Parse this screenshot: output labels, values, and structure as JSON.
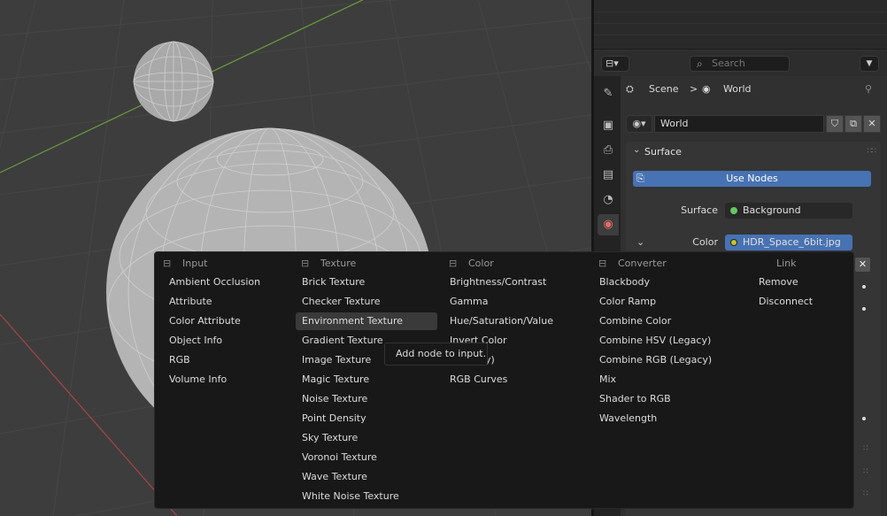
{
  "properties": {
    "header": {
      "editor_icon": "⊟",
      "search_placeholder": "Search",
      "dropdown_icon": "chevron-down"
    },
    "breadcrumb": {
      "scene": "Scene",
      "separator": ">",
      "world": "World",
      "pin_icon": "pin"
    },
    "world_selector": {
      "name": "World",
      "icon": "world-icon"
    },
    "surface_panel": {
      "title": "Surface",
      "use_nodes_label": "Use Nodes",
      "surface_label": "Surface",
      "surface_value": "Background",
      "color_label": "Color",
      "color_value": "HDR_Space_6bit.jpg"
    },
    "colors": {
      "accent": "#4772b3",
      "shader_socket": "#63c763",
      "color_socket": "#c7c729",
      "world_tab": "#e06c6c"
    }
  },
  "menu": {
    "columns": [
      {
        "heading": "Input",
        "items": [
          "Ambient Occlusion",
          "Attribute",
          "Color Attribute",
          "Object Info",
          "RGB",
          "Volume Info"
        ]
      },
      {
        "heading": "Texture",
        "items": [
          "Brick Texture",
          "Checker Texture",
          "Environment Texture",
          "Gradient Texture",
          "Image Texture",
          "Magic Texture",
          "Noise Texture",
          "Point Density",
          "Sky Texture",
          "Voronoi Texture",
          "Wave Texture",
          "White Noise Texture"
        ]
      },
      {
        "heading": "Color",
        "items": [
          "Brightness/Contrast",
          "Gamma",
          "Hue/Saturation/Value",
          "Invert Color",
          "cy)",
          "RGB Curves"
        ]
      },
      {
        "heading": "Converter",
        "items": [
          "Blackbody",
          "Color Ramp",
          "Combine Color",
          "Combine HSV (Legacy)",
          "Combine RGB (Legacy)",
          "Mix",
          "Shader to RGB",
          "Wavelength"
        ]
      },
      {
        "heading": "Link",
        "items": [
          "Remove",
          "Disconnect"
        ]
      }
    ],
    "hovered": "Environment Texture",
    "tooltip": "Add node to input."
  }
}
